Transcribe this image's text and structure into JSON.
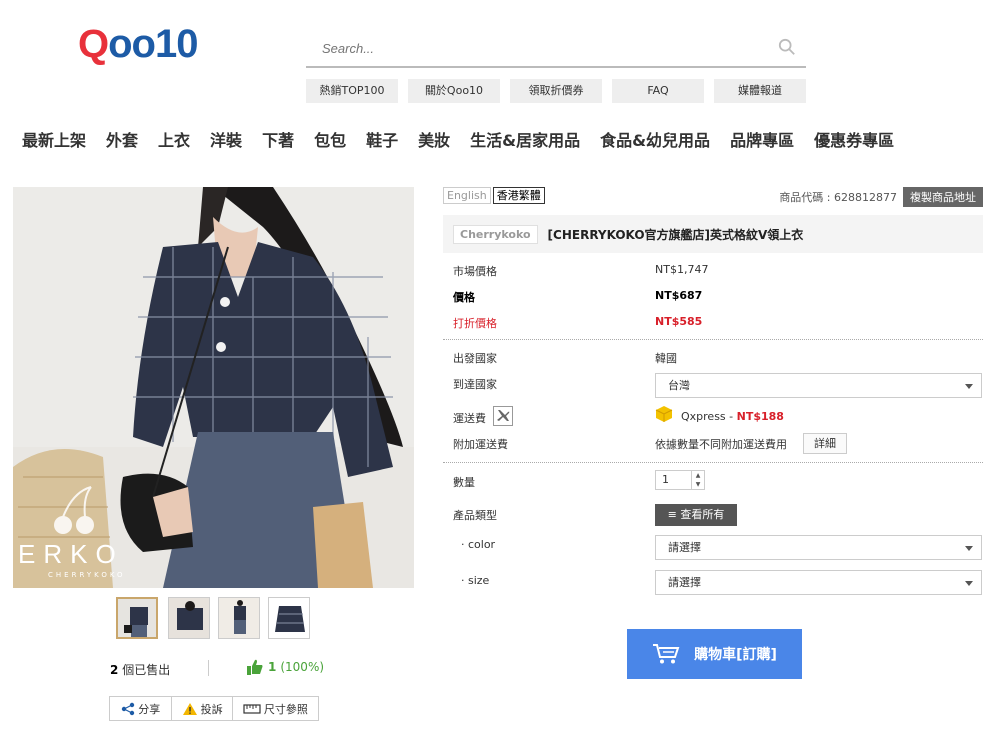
{
  "logo": {
    "q": "Q",
    "rest": "oo10"
  },
  "search": {
    "placeholder": "Search..."
  },
  "quick_links": [
    "熱銷TOP100",
    "關於Qoo10",
    "領取折價券",
    "FAQ",
    "媒體報道"
  ],
  "nav": [
    "最新上架",
    "外套",
    "上衣",
    "洋裝",
    "下著",
    "包包",
    "鞋子",
    "美妝",
    "生活&居家用品",
    "食品&幼兒用品",
    "品牌專區",
    "優惠券專區"
  ],
  "image": {
    "watermark_brand": "ERKO",
    "watermark_sub": "CHERRYKOKO"
  },
  "stats": {
    "sold": "2",
    "sold_label": "個已售出",
    "likes": "1",
    "likes_pct": "(100%)"
  },
  "share_bar": {
    "share": "分享",
    "report": "投訴",
    "size": "尺寸參照"
  },
  "lang": {
    "en": "English",
    "hk": "香港繁體"
  },
  "product": {
    "code_label": "商品代碼 : 628812877",
    "copy_button": "複製商品地址",
    "brand": "Cherrykoko",
    "title": "[CHERRYKOKO官方旗艦店]英式格紋V領上衣"
  },
  "prices": {
    "market_label": "市場價格",
    "market_value": "NT$1,747",
    "price_label": "價格",
    "price_value": "NT$687",
    "discount_label": "打折價格",
    "discount_value": "NT$585"
  },
  "shipping": {
    "origin_label": "出發國家",
    "origin_value": "韓國",
    "dest_label": "到達國家",
    "dest_value": "台灣",
    "fee_label": "運送費",
    "carrier": "Qxpress -",
    "fee_value": "NT$188",
    "extra_label": "附加運送費",
    "extra_value": "依據數量不同附加運送費用",
    "detail_button": "詳細"
  },
  "options": {
    "qty_label": "數量",
    "qty_value": "1",
    "type_label": "產品類型",
    "view_all": "查看所有",
    "color_label": "· color",
    "color_value": "請選擇",
    "size_label": "· size",
    "size_value": "請選擇"
  },
  "cart": {
    "label": "購物車[訂購]"
  }
}
